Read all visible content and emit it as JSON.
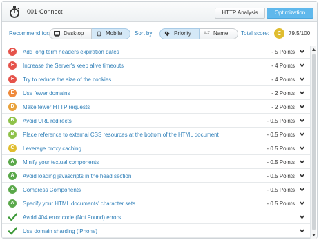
{
  "app": {
    "title": "001-Connect"
  },
  "tabs": [
    {
      "label": "HTTP Analysis",
      "active": false
    },
    {
      "label": "Optimization",
      "active": true
    }
  ],
  "toolbar": {
    "recommend_label": "Recommend for:",
    "desktop_label": "Desktop",
    "mobile_label": "Mobile",
    "selected_device": "Mobile",
    "sortby_label": "Sort by:",
    "priority_label": "Priority",
    "name_label": "Name",
    "name_prefix": "A-Z",
    "selected_sort": "Priority",
    "total_score_label": "Total score:",
    "score_grade": "C",
    "score_value": "79.5/100"
  },
  "grade_colors": {
    "F": "#e5534b",
    "E": "#ef8a3c",
    "D": "#e9a23b",
    "C": "#e0bd2f",
    "B": "#8fc24a",
    "A": "#5aa84a",
    "check": "#3e9a3a"
  },
  "rules": [
    {
      "grade": "F",
      "title": "Add long term headers expiration dates",
      "points": "- 5 Points"
    },
    {
      "grade": "F",
      "title": "Increase the Server's keep alive timeouts",
      "points": "- 4 Points"
    },
    {
      "grade": "F",
      "title": "Try to reduce the size of the cookies",
      "points": "- 4 Points"
    },
    {
      "grade": "E",
      "title": "Use fewer domains",
      "points": "- 2 Points"
    },
    {
      "grade": "D",
      "title": "Make fewer HTTP requests",
      "points": "- 2 Points"
    },
    {
      "grade": "B",
      "title": "Avoid URL redirects",
      "points": "- 0.5 Points"
    },
    {
      "grade": "B",
      "title": "Place reference to external CSS resources at the bottom of the HTML document",
      "points": "- 0.5 Points"
    },
    {
      "grade": "C",
      "title": "Leverage proxy caching",
      "points": "- 0.5 Points"
    },
    {
      "grade": "A",
      "title": "Minify your textual components",
      "points": "- 0.5 Points"
    },
    {
      "grade": "A",
      "title": "Avoid loading javascripts in the head section",
      "points": "- 0.5 Points"
    },
    {
      "grade": "A",
      "title": "Compress Components",
      "points": "- 0.5 Points"
    },
    {
      "grade": "A",
      "title": "Specify your HTML documents' character sets",
      "points": "- 0.5 Points"
    },
    {
      "grade": "check",
      "title": "Avoid 404 error code (Not Found) errors",
      "points": ""
    },
    {
      "grade": "check",
      "title": "Use domain sharding (iPhone)",
      "points": ""
    }
  ]
}
